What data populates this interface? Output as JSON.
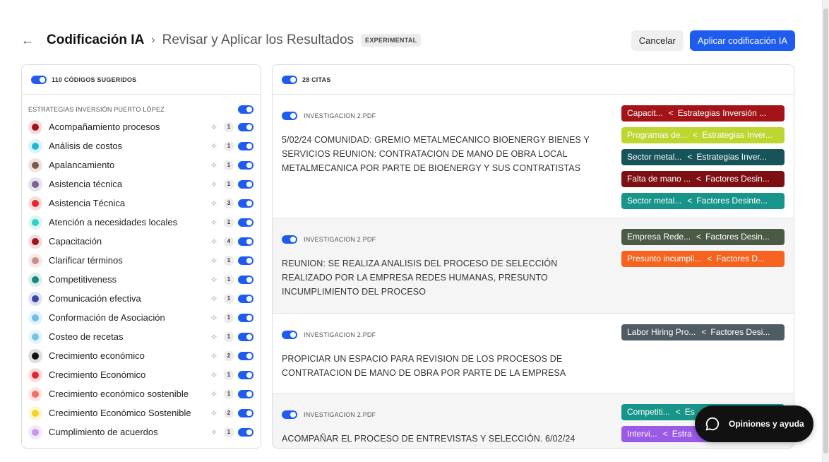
{
  "header": {
    "back_icon": "←",
    "title": "Codificación IA",
    "separator": "›",
    "subtitle": "Revisar y Aplicar los Resultados",
    "badge": "EXPERIMENTAL",
    "cancel_label": "Cancelar",
    "apply_label": "Aplicar codificación IA"
  },
  "left_panel": {
    "header_label": "110 CÓDIGOS SUGERIDOS",
    "group_label": "ESTRATEGIAS INVERSIÓN PUERTO LÓPEZ",
    "codes": [
      {
        "name": "Acompañamiento procesos",
        "count": "1",
        "color": "#a31419",
        "bg": "#f3dcdc"
      },
      {
        "name": "Análisis de costos",
        "count": "1",
        "color": "#1fb8d4",
        "bg": "#dbf2f7"
      },
      {
        "name": "Apalancamiento",
        "count": "1",
        "color": "#7d5a49",
        "bg": "#ece4e0"
      },
      {
        "name": "Asistencia técnica",
        "count": "1",
        "color": "#7a6292",
        "bg": "#e8e2ee"
      },
      {
        "name": "Asistencia Técnica",
        "count": "3",
        "color": "#e8242e",
        "bg": "#fbdcdd"
      },
      {
        "name": "Atención a necesidades locales",
        "count": "1",
        "color": "#2fd2c3",
        "bg": "#dcf6f3"
      },
      {
        "name": "Capacitación",
        "count": "4",
        "color": "#a31419",
        "bg": "#f3dcdc"
      },
      {
        "name": "Clarificar términos",
        "count": "1",
        "color": "#c9908a",
        "bg": "#f5e9e7"
      },
      {
        "name": "Competitiveness",
        "count": "1",
        "color": "#17877a",
        "bg": "#dcefec"
      },
      {
        "name": "Comunicación efectiva",
        "count": "1",
        "color": "#3946a8",
        "bg": "#e0e2f3"
      },
      {
        "name": "Conformación de Asociación",
        "count": "1",
        "color": "#6cbde8",
        "bg": "#e4f2fb"
      },
      {
        "name": "Costeo de recetas",
        "count": "1",
        "color": "#74c3e3",
        "bg": "#e5f3fa"
      },
      {
        "name": "Crecimiento económico",
        "count": "2",
        "color": "#111111",
        "bg": "#dedede"
      },
      {
        "name": "Crecimiento Económico",
        "count": "1",
        "color": "#e8242e",
        "bg": "#fbdcdd"
      },
      {
        "name": "Crecimiento económico sostenible",
        "count": "1",
        "color": "#ef7167",
        "bg": "#fde6e4"
      },
      {
        "name": "Crecimiento Económico Sostenible",
        "count": "2",
        "color": "#f7d21e",
        "bg": "#fdf6d6"
      },
      {
        "name": "Cumplimiento de acuerdos",
        "count": "1",
        "color": "#c99aec",
        "bg": "#f3e8fb"
      }
    ]
  },
  "right_panel": {
    "header_label": "28 CITAS",
    "quotes": [
      {
        "source": "INVESTIGACION 2.PDF",
        "text": "5/02/24 COMUNIDAD: GREMIO METALMECANICO BIOENERGY BIENES Y SERVICIOS REUNION: CONTRATACION DE MANO DE OBRA LOCAL METALMECANICA POR PARTE DE BIOENERGY Y SUS CONTRATISTAS",
        "tags": [
          {
            "code": "Capacit...",
            "group": "Estrategias Inversión ...",
            "color": "#a31419"
          },
          {
            "code": "Programas de...",
            "group": "Estrategias Inver...",
            "color": "#bfd631"
          },
          {
            "code": "Sector metal...",
            "group": "Estrategias Inver...",
            "color": "#17545a"
          },
          {
            "code": "Falta de mano ...",
            "group": "Factores Desin...",
            "color": "#7e0f12"
          },
          {
            "code": "Sector metal...",
            "group": "Factores Desinte...",
            "color": "#17958a"
          }
        ]
      },
      {
        "source": "INVESTIGACION 2.PDF",
        "text": "REUNION: SE REALIZA ANALISIS DEL PROCESO DE SELECCIÓN REALIZADO POR LA EMPRESA REDES HUMANAS, PRESUNTO INCUMPLIMIENTO DEL PROCESO",
        "tags": [
          {
            "code": "Empresa Rede...",
            "group": "Factores Desin...",
            "color": "#4a5a44"
          },
          {
            "code": "Presunto incumpli...",
            "group": "Factores D...",
            "color": "#f5631f"
          }
        ]
      },
      {
        "source": "INVESTIGACION 2.PDF",
        "text": "PROPICIAR UN ESPACIO PARA REVISION DE LOS PROCESOS DE CONTRATACION DE MANO DE OBRA POR PARTE DE LA EMPRESA",
        "tags": [
          {
            "code": "Labor Hiring Pro...",
            "group": "Factores Desi...",
            "color": "#505c64"
          }
        ]
      },
      {
        "source": "INVESTIGACION 2.PDF",
        "text": "ACOMPAÑAR EL PROCESO DE ENTREVISTAS Y SELECCIÓN. 6/02/24",
        "tags": [
          {
            "code": "Competiti...",
            "group": "Es",
            "color": "#17958a"
          },
          {
            "code": "Intervi...",
            "group": "Estra",
            "color": "#9a5ae6"
          },
          {
            "code": "",
            "group": "",
            "color": "#2c2e8a"
          }
        ]
      }
    ]
  },
  "help": {
    "label": "Opiniones y ayuda"
  }
}
